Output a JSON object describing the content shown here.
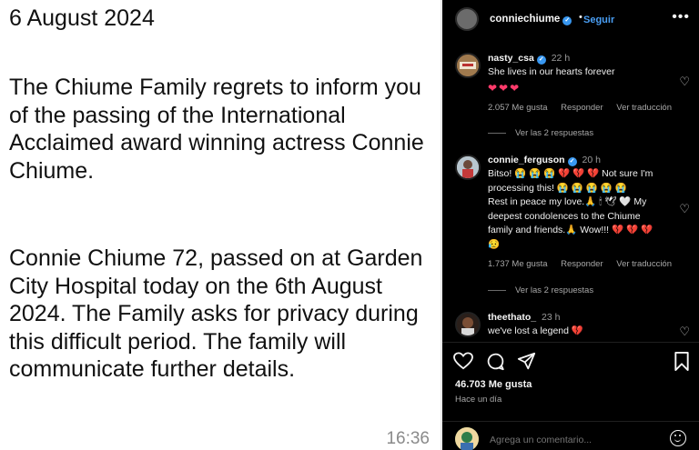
{
  "message": {
    "date": "6 August 2024",
    "paragraph1": "The Chiume Family regrets to inform you of the passing of the International Acclaimed  award winning actress Connie Chiume.",
    "paragraph2": "Connie Chiume 72, passed on at Garden City Hospital today on the 6th August 2024. The Family asks for privacy during this difficult period. The family will communicate further details.",
    "time": "16:36"
  },
  "instagram": {
    "header": {
      "username": "conniechiume",
      "verified_badge": "✓",
      "separator": "•",
      "follow_label": "Seguir",
      "more_icon": "more-icon"
    },
    "comments": [
      {
        "username": "nasty_csa",
        "verified_badge": "✓",
        "time": "22 h",
        "text_line1": "She lives in our hearts forever",
        "text_line2": "❤❤❤",
        "likes": "2.057 Me gusta",
        "reply_label": "Responder",
        "translate_label": "Ver traducción",
        "replies_label": "Ver las 2 respuestas"
      },
      {
        "username": "connie_ferguson",
        "verified_badge": "✓",
        "time": "20 h",
        "text_line1": "Bitso! 😭 😭 😭 💔 💔 💔 Not sure I'm",
        "text_line2": "processing this! 😭 😭 😭 😭 😭",
        "text_line3": "Rest in peace my love.🙏 🕯 🕊 🤍 My",
        "text_line4": "deepest condolences to the Chiume",
        "text_line5": "family and friends.🙏 Wow!!! 💔 💔 💔",
        "text_line6": "😥",
        "likes": "1.737 Me gusta",
        "reply_label": "Responder",
        "translate_label": "Ver traducción",
        "replies_label": "Ver las 2 respuestas"
      },
      {
        "username": "theethato_",
        "time": "23 h",
        "text_line1": "we've lost a legend 💔"
      }
    ],
    "likes_total": "46.703 Me gusta",
    "posted_ago": "Hace un día",
    "add_comment_placeholder": "Agrega un comentario..."
  },
  "colors": {
    "accent_blue": "#4a9ff5",
    "verified_blue": "#3897f0",
    "heart_red": "#ff3b6b"
  }
}
